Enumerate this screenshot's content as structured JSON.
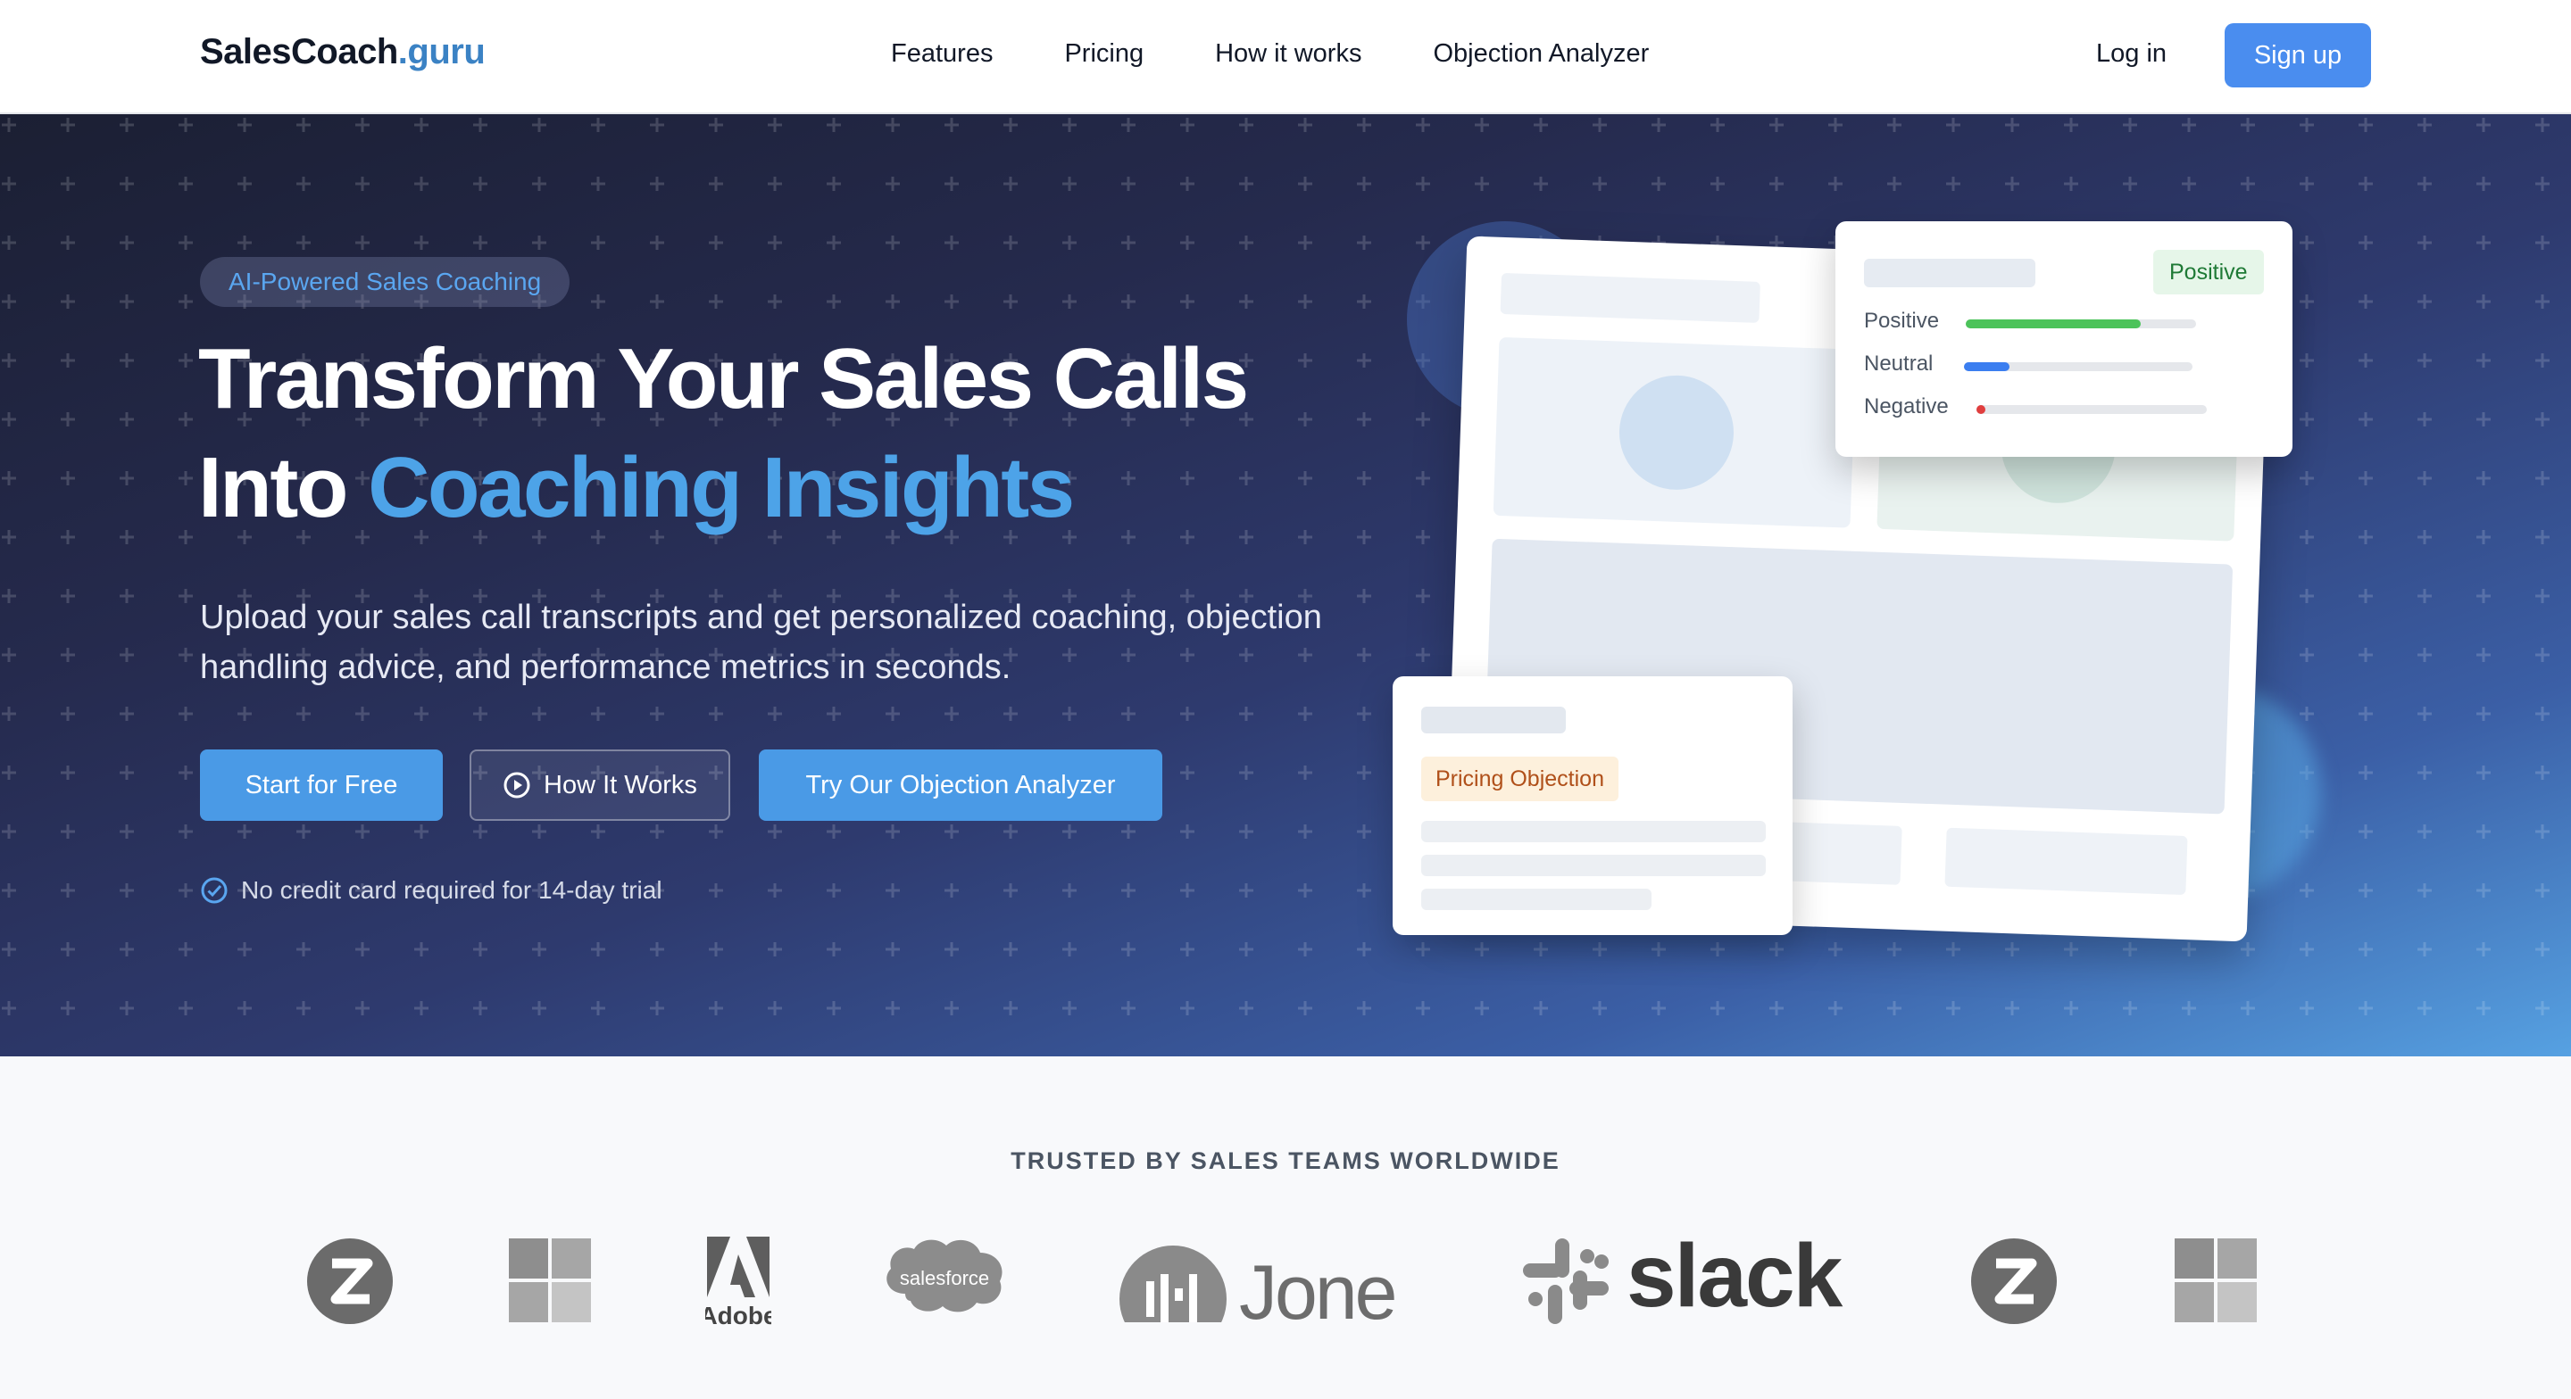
{
  "nav": {
    "brand_main": "SalesCoach",
    "brand_accent": ".guru",
    "links": [
      "Features",
      "Pricing",
      "How it works",
      "Objection Analyzer"
    ],
    "login": "Log in",
    "signup": "Sign up"
  },
  "hero": {
    "badge": "AI-Powered Sales Coaching",
    "headline_line1": "Transform Your Sales Calls",
    "headline_line2_plain": "Into ",
    "headline_line2_accent": "Coaching Insights",
    "subtext": "Upload your sales call transcripts and get personalized coaching, objection handling advice, and performance metrics in seconds.",
    "buttons": {
      "start": "Start for Free",
      "how": "How It Works",
      "objection": "Try Our Objection Analyzer"
    },
    "trial_note": "No credit card required for 14-day trial"
  },
  "illustration": {
    "sentiment_badge": "Positive",
    "sentiment_rows": [
      {
        "label": "Positive",
        "level": 0.76,
        "color": "#4cc35a"
      },
      {
        "label": "Neutral",
        "level": 0.2,
        "color": "#3b7ef0"
      },
      {
        "label": "Negative",
        "level": 0.04,
        "color": "#e03e3e"
      }
    ],
    "objection_tag": "Pricing Objection"
  },
  "trusted": {
    "title": "TRUSTED BY SALES TEAMS WORLDWIDE",
    "logos": [
      {
        "name": "z-logo-icon",
        "text": "Z"
      },
      {
        "name": "windows-logo-icon",
        "text": ""
      },
      {
        "name": "adobe-logo",
        "text": "Adobe"
      },
      {
        "name": "salesforce-logo",
        "text": "salesforce"
      },
      {
        "name": "jone-logo",
        "text": "Jone"
      },
      {
        "name": "slack-logo",
        "text": "slack"
      },
      {
        "name": "z-logo-icon",
        "text": "Z"
      },
      {
        "name": "windows-logo-icon",
        "text": ""
      }
    ]
  }
}
